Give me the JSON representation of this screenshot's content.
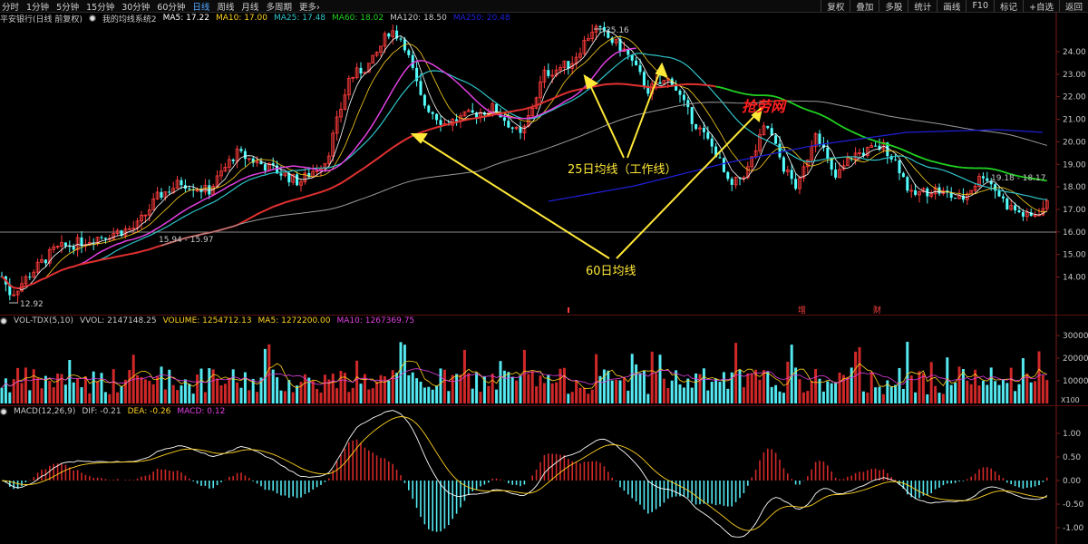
{
  "toolbar": {
    "periods": [
      "分时",
      "1分钟",
      "5分钟",
      "15分钟",
      "30分钟",
      "60分钟",
      "日线",
      "周线",
      "月线",
      "多周期",
      "更多"
    ],
    "active_period": "日线",
    "right": [
      "复权",
      "叠加",
      "多股",
      "统计",
      "画线",
      "F10",
      "标记",
      "+自选",
      "返回"
    ],
    "more_arrow": "›"
  },
  "main_info": {
    "title": "平安银行(日线 前复权)",
    "system": "我的均线系统2",
    "ma": [
      {
        "label": "MA5: 17.22",
        "color": "#ffffff"
      },
      {
        "label": "MA10: 17.00",
        "color": "#ffd21f"
      },
      {
        "label": "MA25: 17.48",
        "color": "#2fc3c8"
      },
      {
        "label": "MA60: 18.02",
        "color": "#20d020"
      },
      {
        "label": "MA120: 18.50",
        "color": "#c8c8c8"
      },
      {
        "label": "MA250: 20.48",
        "color": "#2020d8"
      }
    ]
  },
  "vol_info": {
    "title": "VOL-TDX(5,10)",
    "items": [
      {
        "label": "VVOL: 2147148.25",
        "color": "#c8c8c8"
      },
      {
        "label": "VOLUME: 1254712.13",
        "color": "#ffd21f"
      },
      {
        "label": "MA5: 1272200.00",
        "color": "#ffd21f"
      },
      {
        "label": "MA10: 1267369.75",
        "color": "#e040e0"
      }
    ]
  },
  "macd_info": {
    "title": "MACD(12,26,9)",
    "items": [
      {
        "label": "DIF: -0.21",
        "color": "#c8c8c8"
      },
      {
        "label": "DEA: -0.26",
        "color": "#ffd21f"
      },
      {
        "label": "MACD: 0.12",
        "color": "#e040e0"
      }
    ]
  },
  "price_axis": [
    "24.00",
    "23.00",
    "22.00",
    "21.00",
    "20.00",
    "19.00",
    "18.00",
    "17.00",
    "16.00",
    "15.00",
    "14.00"
  ],
  "vol_axis": [
    "30000",
    "20000",
    "10000"
  ],
  "vol_unit": "X100",
  "macd_axis": [
    "1.00",
    "0.50",
    "0.00",
    "-0.50",
    "-1.00"
  ],
  "price_marks": {
    "high": "25.16",
    "low": "12.92",
    "mid": "15.94 - 15.97",
    "recent": "19.18 - 18.17"
  },
  "annotations": {
    "ma25": "25日均线（工作线）",
    "ma60": "60日均线"
  },
  "watermark": "抢劳网",
  "event_markers": [
    "增",
    "财"
  ],
  "colors": {
    "up": "#ff3c3c",
    "down": "#54ffff",
    "ma5": "#ffffff",
    "ma10": "#ffd21f",
    "ma25": "#2fc3c8",
    "ma60_rising": "#e03030",
    "ma60_flat": "#20d020",
    "ma120": "#9a9a9a",
    "ma250": "#2020d8",
    "annotation": "#ffe838",
    "watermark": "#ff2020"
  }
}
